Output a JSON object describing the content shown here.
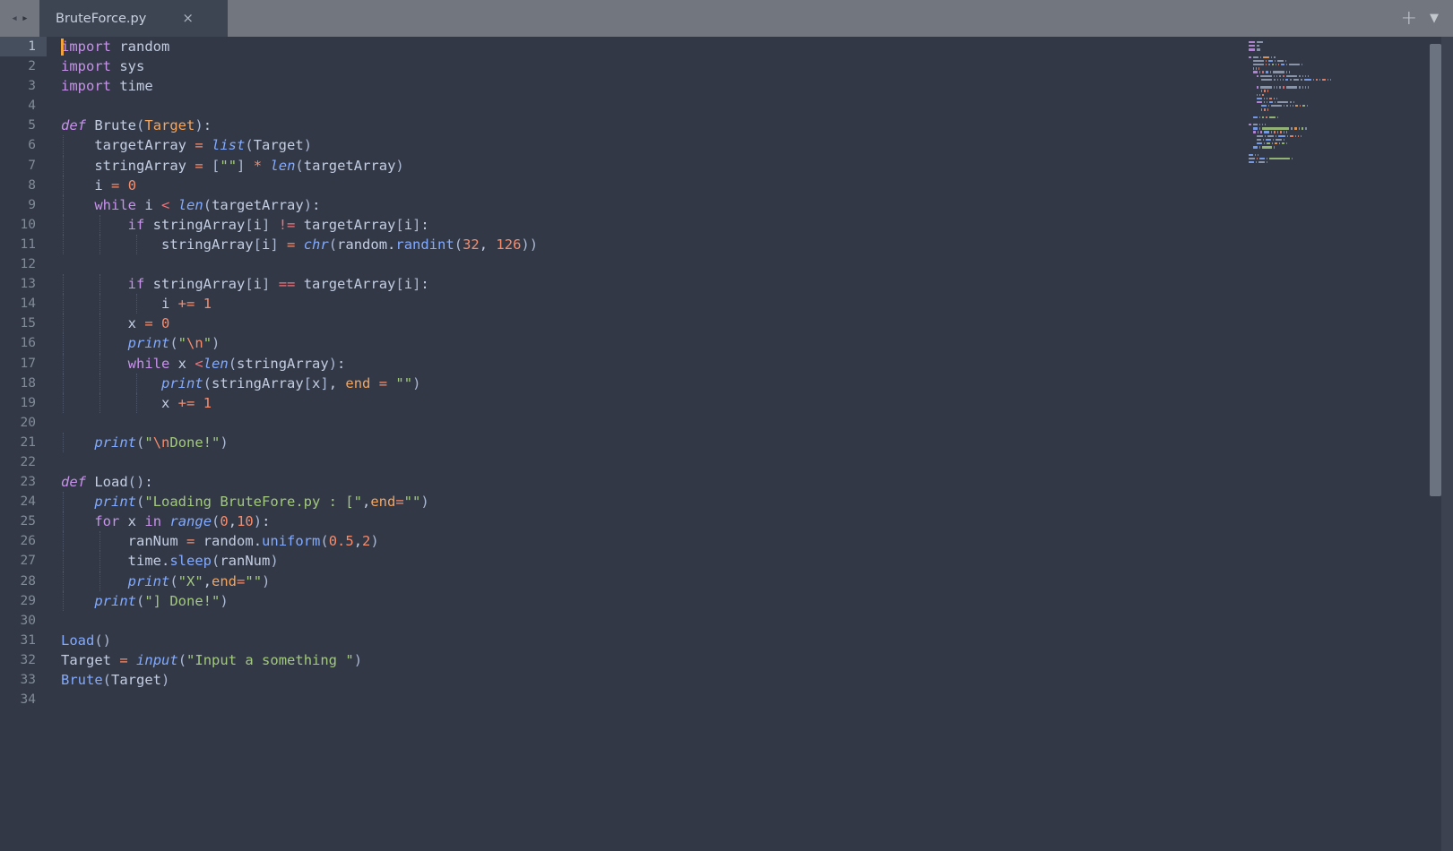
{
  "window": {
    "title": "BruteForce.py"
  },
  "tabbar": {
    "nav_back_icon": "chevron-left-icon",
    "nav_forward_icon": "chevron-right-icon",
    "tab_label": "BruteForce.py",
    "close_icon": "×",
    "new_tab_icon": "+",
    "tab_menu_icon": "▼"
  },
  "colors": {
    "tabbar_bg": "#72777f",
    "active_tab_bg": "#3d4452",
    "editor_bg": "#323845",
    "gutter_fg": "#818b99",
    "active_line_bg": "#454f5e",
    "cursor": "#f2a33c",
    "keyword": "#c792ea",
    "builtin": "#82aaff",
    "function_def": "#80cbc4",
    "string": "#a3c97e",
    "number": "#f78c6c",
    "operator": "#f78c6c",
    "comparison": "#f0737a",
    "identifier": "#c3cee3",
    "bracket": "#abb8d4",
    "param": "#f2a661",
    "scrollbar_thumb": "#6b7380"
  },
  "editor": {
    "language": "Python",
    "total_lines": 34,
    "active_line": 1,
    "cursor_line": 1,
    "cursor_column": 1,
    "line_numbers": [
      1,
      2,
      3,
      4,
      5,
      6,
      7,
      8,
      9,
      10,
      11,
      12,
      13,
      14,
      15,
      16,
      17,
      18,
      19,
      20,
      21,
      22,
      23,
      24,
      25,
      26,
      27,
      28,
      29,
      30,
      31,
      32,
      33,
      34
    ],
    "lines": [
      "import random",
      "import sys",
      "import time",
      "",
      "def Brute(Target):",
      "    targetArray = list(Target)",
      "    stringArray = [\"\"] * len(targetArray)",
      "    i = 0",
      "    while i < len(targetArray):",
      "        if stringArray[i] != targetArray[i]:",
      "            stringArray[i] = chr(random.randint(32, 126))",
      "",
      "        if stringArray[i] == targetArray[i]:",
      "            i += 1",
      "        x = 0",
      "        print(\"\\n\")",
      "        while x <len(stringArray):",
      "            print(stringArray[x], end = \"\")",
      "            x += 1",
      "",
      "    print(\"\\nDone!\")",
      "",
      "def Load():",
      "    print(\"Loading BruteFore.py : [\",end=\"\")",
      "    for x in range(0,10):",
      "        ranNum = random.uniform(0.5,2)",
      "        time.sleep(ranNum)",
      "        print(\"X\",end=\"\")",
      "    print(\"] Done!\")",
      "",
      "Load()",
      "Target = input(\"Input a something \")",
      "Brute(Target)",
      ""
    ]
  },
  "minimap": {
    "name": "code-minimap",
    "visible": true
  },
  "scrollbar": {
    "name": "vertical-scrollbar",
    "orientation": "vertical"
  }
}
